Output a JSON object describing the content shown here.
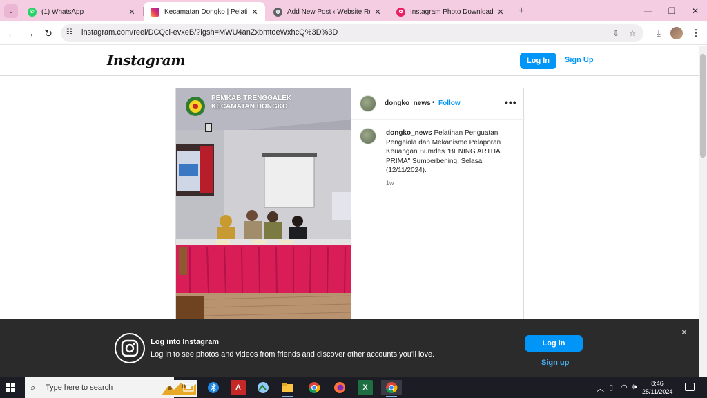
{
  "browser": {
    "tabs": [
      {
        "title": "(1) WhatsApp",
        "icon": "whatsapp-icon",
        "color": "#25d366",
        "active": false
      },
      {
        "title": "Kecamatan Dongko | Pelatihan",
        "icon": "instagram-icon",
        "color": "#e1306c",
        "active": true
      },
      {
        "title": "Add New Post ‹ Website Resmi",
        "icon": "globe-icon",
        "color": "#5f6368",
        "active": false
      },
      {
        "title": "Instagram Photo Downloader -",
        "icon": "downloader-icon",
        "color": "#e91e63",
        "active": false
      }
    ],
    "url": "instagram.com/reel/DCQcl-evxeB/?igsh=MWU4anZxbmtoeWxhcQ%3D%3D"
  },
  "instagram": {
    "logo": "Instagram",
    "login_label": "Log In",
    "signup_label": "Sign Up"
  },
  "post": {
    "image_overlay": {
      "line1": "PEMKAB TRENGGALEK",
      "line2": "KECAMATAN DONGKO"
    },
    "username": "dongko_news",
    "separator": "•",
    "follow_label": "Follow",
    "more_label": "•••",
    "caption_user": "dongko_news",
    "caption_text": " Pelatihan Penguatan Pengelola dan Mekanisme Pelaporan Keuangan Bumdes \"BENING ARTHA PRIMA\" Sumberbening, Selasa (12/11/2024).",
    "age": "1w"
  },
  "banner": {
    "title": "Log into Instagram",
    "text": "Log in to see photos and videos from friends and discover other accounts you'll love.",
    "login_label": "Log in",
    "signup_label": "Sign up",
    "close_label": "×"
  },
  "taskbar": {
    "search_placeholder": "Type here to search",
    "time": "8:46",
    "date": "25/11/2024"
  },
  "colors": {
    "accent": "#0095f6",
    "tabbar": "#f5cde3",
    "banner": "#2b2b2b",
    "table_cloth": "#d91e57"
  }
}
